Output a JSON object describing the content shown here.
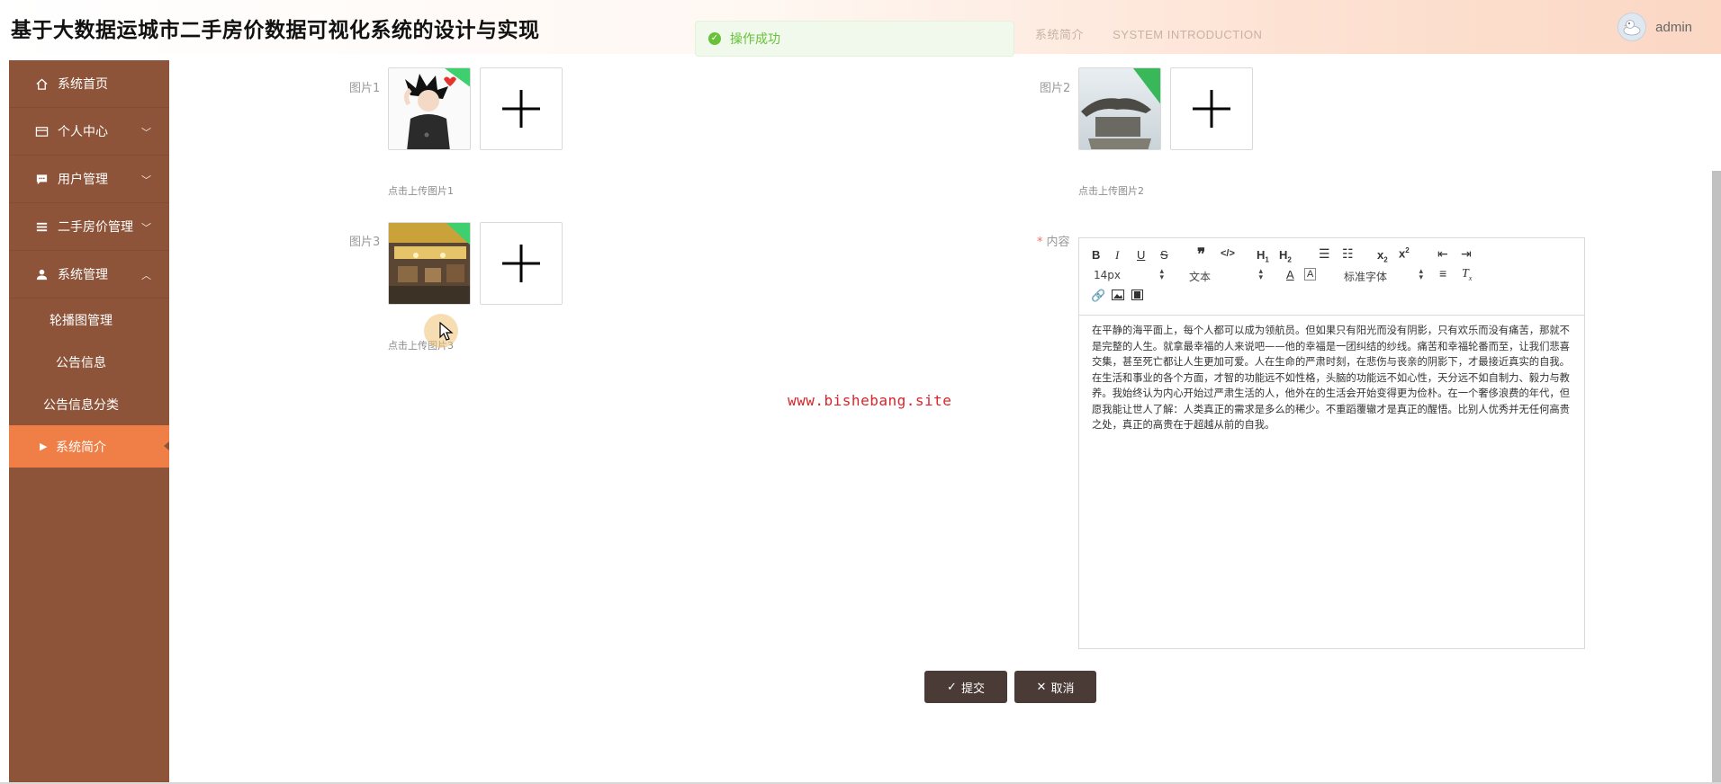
{
  "header": {
    "app_title": "基于大数据运城市二手房价数据可视化系统的设计与实现",
    "ghost_cn": "系统简介",
    "ghost_en": "SYSTEM INTRODUCTION",
    "username": "admin"
  },
  "toast": {
    "message": "操作成功",
    "status_color": "#67c23a"
  },
  "sidebar": {
    "bg_color": "#8e543a",
    "active_color": "#ef7f47",
    "items": [
      {
        "label": "系统首页",
        "icon": "home-icon"
      },
      {
        "label": "个人中心",
        "icon": "wallet-icon",
        "arrow": "chevron-down"
      },
      {
        "label": "用户管理",
        "icon": "chat-icon",
        "arrow": "chevron-down"
      },
      {
        "label": "二手房价管理",
        "icon": "list-icon",
        "arrow": "chevron-down"
      },
      {
        "label": "系统管理",
        "icon": "user-icon",
        "arrow": "chevron-up"
      }
    ],
    "submenu": [
      {
        "label": "轮播图管理"
      },
      {
        "label": "公告信息"
      },
      {
        "label": "公告信息分类"
      },
      {
        "label": "系统简介",
        "active": true
      }
    ]
  },
  "form": {
    "picture1": {
      "label": "图片1",
      "hint": "点击上传图片1"
    },
    "picture2": {
      "label": "图片2",
      "hint": "点击上传图片2"
    },
    "picture3": {
      "label": "图片3",
      "hint": "点击上传图片3"
    },
    "content": {
      "label": "内容",
      "required_mark": "*",
      "font_size": "14px",
      "text_style": "文本",
      "font_family": "标准字体",
      "text": "在平静的海平面上，每个人都可以成为领航员。但如果只有阳光而没有阴影，只有欢乐而没有痛苦，那就不是完整的人生。就拿最幸福的人来说吧——他的幸福是一团纠结的纱线。痛苦和幸福轮番而至，让我们悲喜交集，甚至死亡都让人生更加可爱。人在生命的严肃时刻，在悲伤与丧亲的阴影下，才最接近真实的自我。在生活和事业的各个方面，才智的功能远不如性格，头脑的功能远不如心性，天分远不如自制力、毅力与教养。我始终认为内心开始过严肃生活的人，他外在的生活会开始变得更为俭朴。在一个奢侈浪费的年代，但愿我能让世人了解：人类真正的需求是多么的稀少。不重蹈覆辙才是真正的醒悟。比别人优秀并无任何高贵之处，真正的高贵在于超越从前的自我。"
    },
    "submit_label": "提交",
    "cancel_label": "取消"
  },
  "watermark": "www.bishebang.site"
}
